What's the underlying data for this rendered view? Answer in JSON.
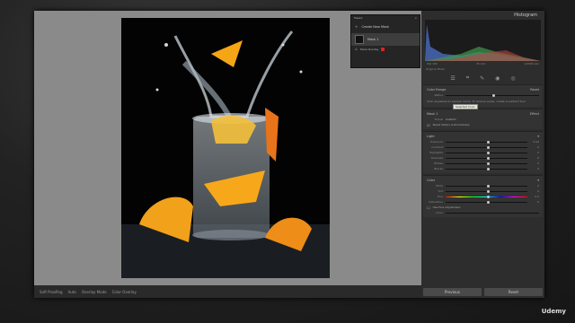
{
  "panel": {
    "histogram_title": "Histogram",
    "hist_left": "ISO 100",
    "hist_mid": "35 mm",
    "hist_right": "1/2000 sec",
    "original_photo": "Original Photo",
    "color_range": "Color Range",
    "reset": "Reset",
    "refine": "Refine",
    "hint": "Click anywhere to sample colors. To remove areas, create a subtract tool.",
    "mask_name": "Mask 1",
    "effect": "Effect",
    "preset": "Preset",
    "preset_value": "Custom",
    "reset_sliders": "Reset Sliders Automatically",
    "light": "Light",
    "color": "Color",
    "sliders_light": [
      {
        "label": "Exposure",
        "value": "0.00"
      },
      {
        "label": "Contrast",
        "value": "0"
      },
      {
        "label": "Highlights",
        "value": "0"
      },
      {
        "label": "Shadows",
        "value": "0"
      },
      {
        "label": "Whites",
        "value": "0"
      },
      {
        "label": "Blacks",
        "value": "0"
      }
    ],
    "sliders_color": [
      {
        "label": "Temp",
        "value": "0"
      },
      {
        "label": "Tint",
        "value": "0"
      },
      {
        "label": "Hue",
        "value": "0.0"
      },
      {
        "label": "Saturation",
        "value": "0"
      }
    ],
    "fine_adjust": "Use Fine Adjustment",
    "color_label": "Color",
    "previous": "Previous",
    "reset_btn": "Reset"
  },
  "masks": {
    "title": "Masks",
    "create": "Create New Mask",
    "mask1": "Mask 1",
    "show_overlay": "Show Overlay"
  },
  "filmstrip": {
    "items": [
      "Soft Proofing",
      "Auto",
      "Overlay Mode",
      "Color Overlay"
    ]
  },
  "tooltip": "Selected Color",
  "watermark": "Udemy"
}
